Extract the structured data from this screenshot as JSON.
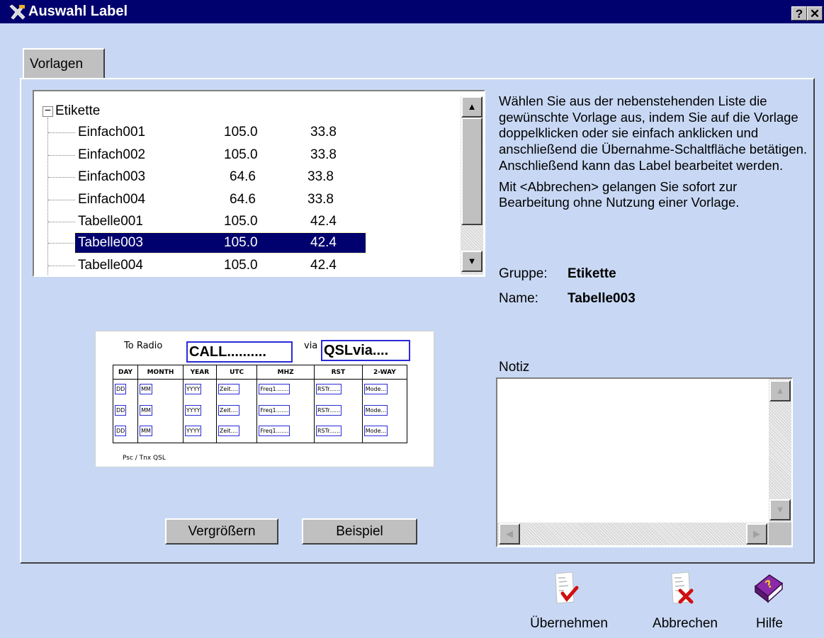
{
  "window": {
    "title": "Auswahl Label",
    "help_button": "?",
    "close_button": "✕"
  },
  "tabs": [
    {
      "label": "Vorlagen"
    }
  ],
  "tree": {
    "root_label": "Etikette",
    "items": [
      {
        "name": "Einfach001",
        "width": "105.0",
        "height": "33.8"
      },
      {
        "name": "Einfach002",
        "width": "105.0",
        "height": "33.8"
      },
      {
        "name": "Einfach003",
        "width": "64.6",
        "height": "33.8"
      },
      {
        "name": "Einfach004",
        "width": "64.6",
        "height": "33.8"
      },
      {
        "name": "Tabelle001",
        "width": "105.0",
        "height": "42.4"
      },
      {
        "name": "Tabelle003",
        "width": "105.0",
        "height": "42.4",
        "selected": true
      },
      {
        "name": "Tabelle004",
        "width": "105.0",
        "height": "42.4"
      }
    ]
  },
  "preview": {
    "to_radio": "To Radio",
    "call_field": "CALL..........",
    "via": "via",
    "qsl_field": "QSLvia....",
    "headers": [
      "DAY",
      "MONTH",
      "YEAR",
      "UTC",
      "MHZ",
      "RST",
      "2-WAY"
    ],
    "rows": [
      [
        "DD",
        "MM",
        "YYYY",
        "Zeit....",
        "Freq1.......",
        "RSTr......",
        "Mode..."
      ],
      [
        "DD",
        "MM",
        "YYYY",
        "Zeit....",
        "Freq1.......",
        "RSTr......",
        "Mode..."
      ],
      [
        "DD",
        "MM",
        "YYYY",
        "Zeit....",
        "Freq1.......",
        "RSTr......",
        "Mode..."
      ]
    ],
    "footer": "Psc / Tnx  QSL"
  },
  "buttons": {
    "enlarge": "Vergrößern",
    "example": "Beispiel"
  },
  "description": {
    "paragraph1": "Wählen Sie aus der nebenstehenden Liste die gewünschte Vorlage aus, indem Sie auf die Vorlage doppelklicken oder sie einfach anklicken und anschließend die Übernahme-Schaltfläche betätigen.        Anschließend kann das Label bearbeitet werden.",
    "paragraph2": "Mit <Abbrechen> gelangen Sie sofort zur Bearbeitung ohne Nutzung einer Vorlage."
  },
  "info": {
    "group_label": "Gruppe:",
    "group_value": "Etikette",
    "name_label": "Name:",
    "name_value": "Tabelle003"
  },
  "notes": {
    "label": "Notiz",
    "value": ""
  },
  "actions": {
    "apply": "Übernehmen",
    "cancel": "Abbrechen",
    "help": "Hilfe"
  },
  "icons": {
    "app": "tools-icon",
    "apply": "document-check-icon",
    "cancel": "document-x-icon",
    "help": "help-book-icon"
  },
  "colors": {
    "titlebar": "#00006e",
    "background": "#c8d8f4",
    "selection": "#00006e",
    "field_border": "#2a2ad8"
  }
}
